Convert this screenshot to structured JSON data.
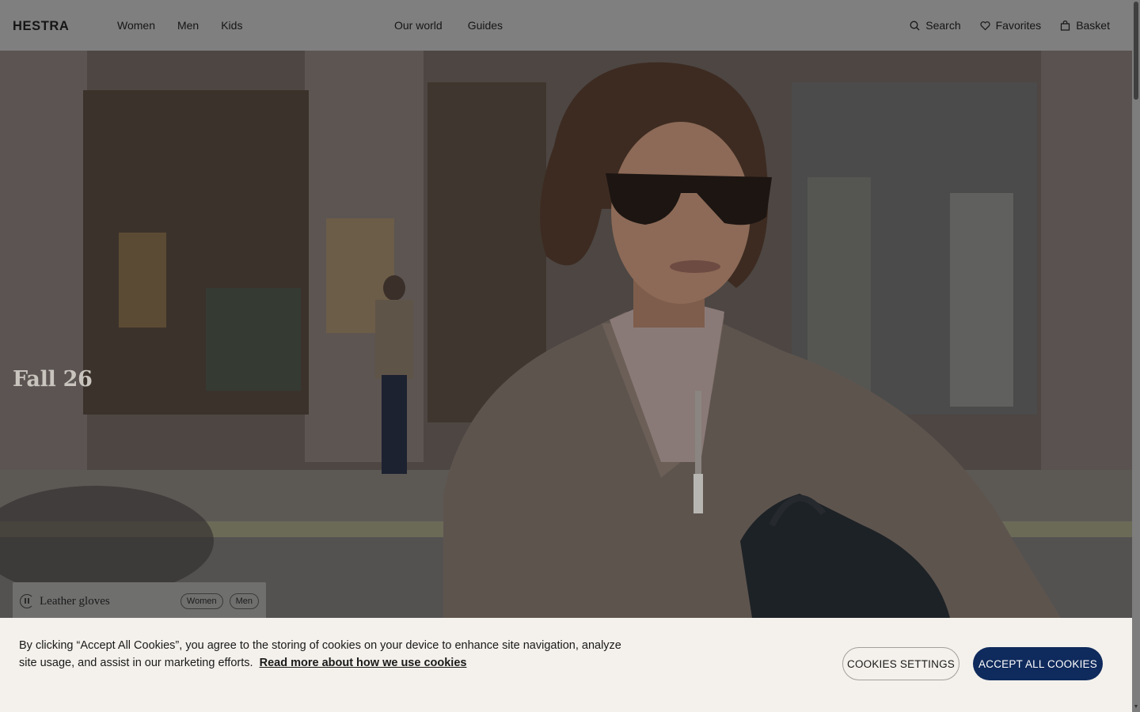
{
  "header": {
    "logo_text": "HESTRA",
    "nav_left": [
      "Women",
      "Men",
      "Kids"
    ],
    "nav_center": [
      "Our world",
      "Guides"
    ],
    "search_label": "Search",
    "favorites_label": "Favorites",
    "basket_label": "Basket"
  },
  "hero": {
    "title": "Fall 26",
    "chip": {
      "label": "Leather gloves",
      "tags": [
        "Women",
        "Men"
      ]
    }
  },
  "cookie_banner": {
    "text": "By clicking “Accept All Cookies”, you agree to the storing of cookies on your device to enhance site navigation, analyze site usage, and assist in our marketing efforts.",
    "link_text": "Read more about how we use cookies",
    "settings_button": "COOKIES SETTINGS",
    "accept_button": "ACCEPT ALL COOKIES"
  },
  "icons": {
    "search": "search-icon",
    "favorites": "heart-icon",
    "basket": "bag-icon",
    "play": "pause-icon"
  },
  "colors": {
    "accent": "#0f2a5c",
    "banner_bg": "#f4f1ec"
  }
}
